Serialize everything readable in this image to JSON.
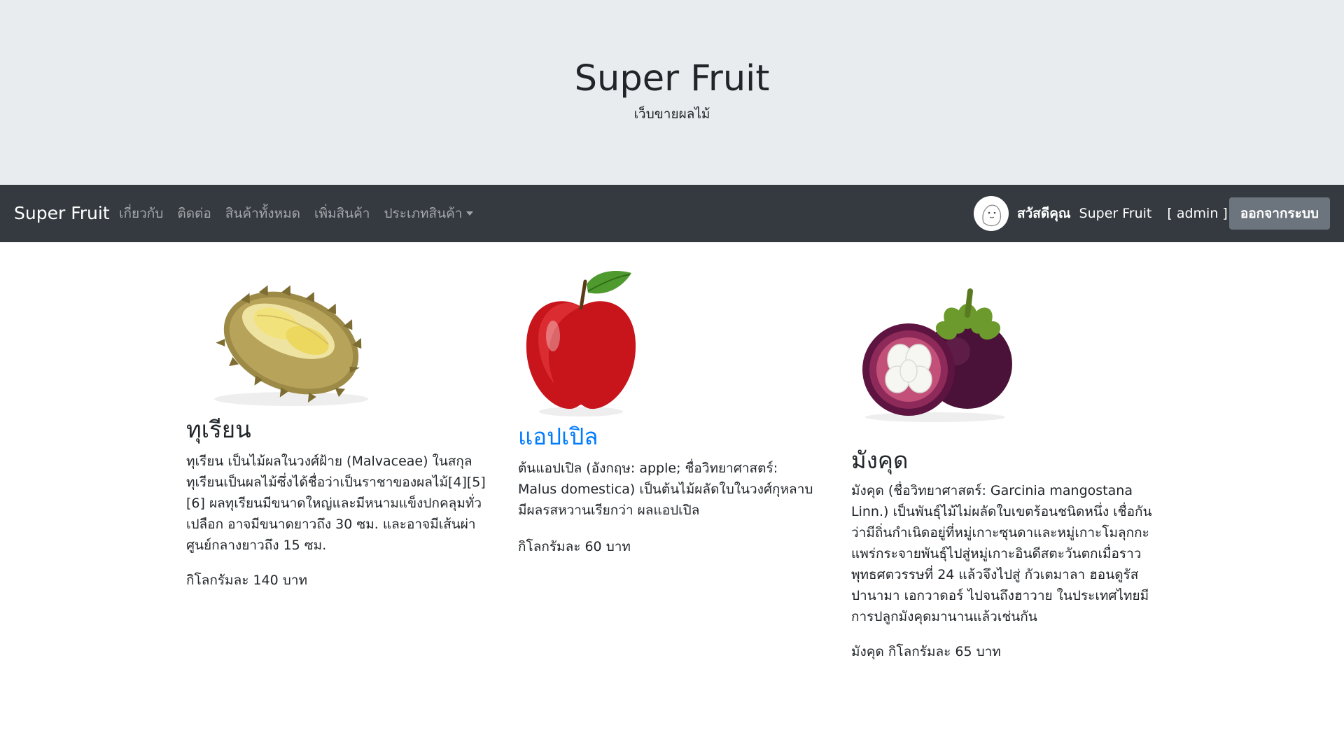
{
  "header": {
    "title": "Super Fruit",
    "subtitle": "เว็บขายผลไม้"
  },
  "navbar": {
    "brand": "Super Fruit",
    "links": [
      {
        "label": "เกี่ยวกับ"
      },
      {
        "label": "ติดต่อ"
      },
      {
        "label": "สินค้าทั้งหมด"
      },
      {
        "label": "เพิ่มสินค้า"
      },
      {
        "label": "ประเภทสินค้า"
      }
    ],
    "greeting": "สวัสดีคุณ",
    "user_name": "Super Fruit",
    "role": "[ admin ]",
    "logout_label": "ออกจากระบบ",
    "bg_color": "#343a40"
  },
  "products": [
    {
      "name": "ทุเรียน",
      "description": "ทุเรียน เป็นไม้ผลในวงศ์ฝ้าย (Malvaceae) ในสกุลทุเรียนเป็นผลไม้ซึ่งได้ชื่อว่าเป็นราชาของผลไม้[4][5][6] ผลทุเรียนมีขนาดใหญ่และมีหนามแข็งปกคลุมทั่วเปลือก อาจมีขนาดยาวถึง 30 ซม. และอาจมีเส้นผ่าศูนย์กลางยาวถึง 15 ซม.",
      "price": "กิโลกรัมละ 140 บาท",
      "icon": "durian-image"
    },
    {
      "name": "แอปเปิล",
      "description": "ต้นแอปเปิล (อังกฤษ: apple; ชื่อวิทยาศาสตร์: Malus domestica) เป็นต้นไม้ผลัดใบในวงศ์กุหลาบ มีผลรสหวานเรียกว่า ผลแอปเปิล",
      "price": "กิโลกรัมละ 60 บาท",
      "icon": "apple-image"
    },
    {
      "name": "มังคุด",
      "description": "มังคุด (ชื่อวิทยาศาสตร์: Garcinia mangostana Linn.) เป็นพันธุ์ไม้ไม่ผลัดใบเขตร้อนชนิดหนึ่ง เชื่อกันว่ามีถิ่นกำเนิดอยู่ที่หมู่เกาะซุนดาและหมู่เกาะโมลุกกะ แพร่กระจายพันธุ์ไปสู่หมู่เกาะอินดีสตะวันตกเมื่อราวพุทธศตวรรษที่ 24 แล้วจึงไปสู่ กัวเตมาลา ฮอนดูรัส ปานามา เอกวาดอร์ ไปจนถึงฮาวาย ในประเทศไทยมีการปลูกมังคุดมานานแล้วเช่นกัน",
      "price": "มังคุด กิโลกรัมละ 65 บาท",
      "icon": "mangosteen-image"
    }
  ],
  "colors": {
    "jumbotron_bg": "#e9ecef",
    "link": "#007bff",
    "logout_button": "#6c757d"
  }
}
